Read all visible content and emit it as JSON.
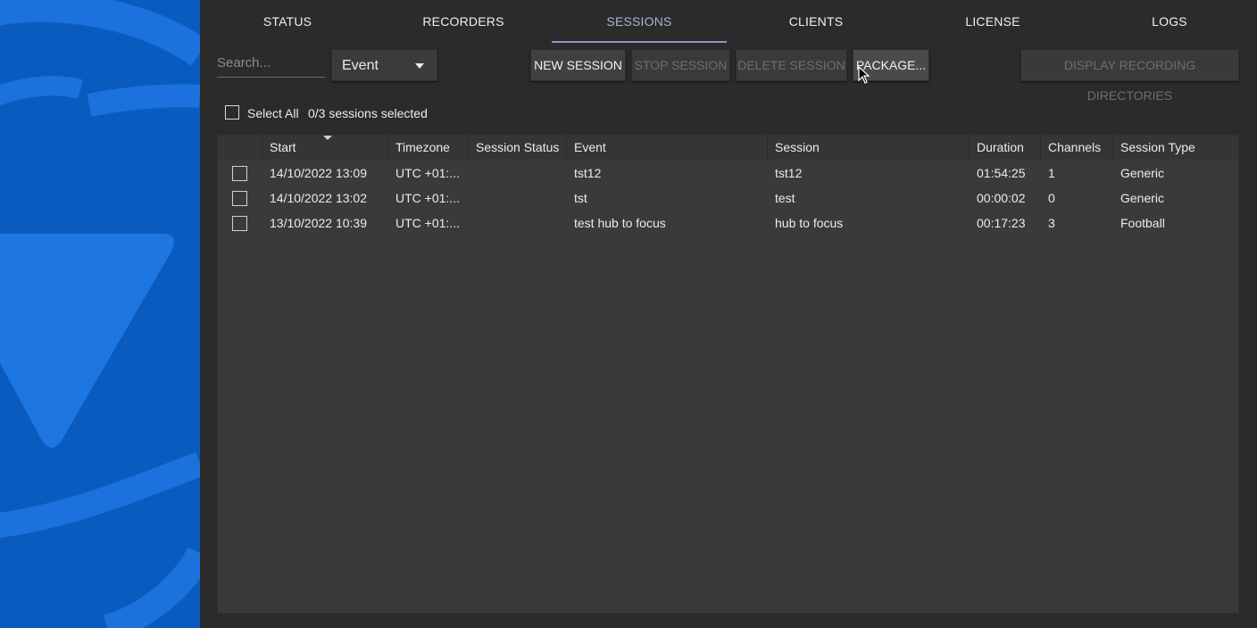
{
  "tabs": [
    {
      "label": "STATUS"
    },
    {
      "label": "RECORDERS"
    },
    {
      "label": "SESSIONS"
    },
    {
      "label": "CLIENTS"
    },
    {
      "label": "LICENSE"
    },
    {
      "label": "LOGS"
    }
  ],
  "active_tab": "SESSIONS",
  "toolbar": {
    "search_placeholder": "Search...",
    "filter_value": "Event",
    "new_session": "NEW SESSION",
    "stop_session": "STOP SESSION",
    "delete_session": "DELETE SESSION",
    "package": "PACKAGE...",
    "display_dirs": "DISPLAY RECORDING DIRECTORIES"
  },
  "selection": {
    "select_all_label": "Select All",
    "count_text": "0/3 sessions selected"
  },
  "table": {
    "columns": [
      "Start",
      "Timezone",
      "Session Status",
      "Event",
      "Session",
      "Duration",
      "Channels",
      "Session Type"
    ],
    "rows": [
      {
        "start": "14/10/2022 13:09",
        "timezone": "UTC +01:...",
        "status": "",
        "event": "tst12",
        "session": "tst12",
        "duration": "01:54:25",
        "channels": "1",
        "type": "Generic"
      },
      {
        "start": "14/10/2022 13:02",
        "timezone": "UTC +01:...",
        "status": "",
        "event": "tst",
        "session": "test",
        "duration": "00:00:02",
        "channels": "0",
        "type": "Generic"
      },
      {
        "start": "13/10/2022 10:39",
        "timezone": "UTC +01:...",
        "status": "",
        "event": "test hub to focus",
        "session": "hub to focus",
        "duration": "00:17:23",
        "channels": "3",
        "type": "Football"
      }
    ]
  },
  "colors": {
    "brand_blue": "#0a5bbf",
    "background": "#2b2b2b",
    "active_tab": "#a9b3d6"
  }
}
